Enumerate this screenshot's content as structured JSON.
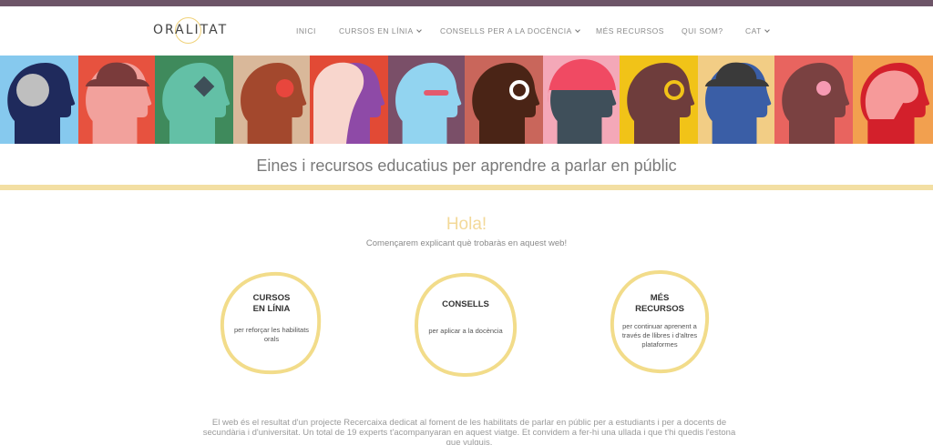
{
  "header": {
    "logo": "ORALITAT",
    "nav": [
      {
        "label": "INICI",
        "dropdown": false
      },
      {
        "label": "CURSOS EN LÍNIA",
        "dropdown": true
      },
      {
        "label": "CONSELLS PER A LA DOCÈNCIA",
        "dropdown": true
      },
      {
        "label": "MÉS RECURSOS",
        "dropdown": false
      },
      {
        "label": "QUI SOM?",
        "dropdown": false
      },
      {
        "label": "CAT",
        "dropdown": true
      }
    ]
  },
  "banner": {
    "tiles": [
      {
        "bg": "#86c9ee",
        "head": "#1f2a5c",
        "accent": "#bfbfbf",
        "motif": "circle-face"
      },
      {
        "bg": "#e7523f",
        "head": "#f2a19c",
        "accent": "#7a3b3b",
        "motif": "hat"
      },
      {
        "bg": "#3f8a5c",
        "head": "#63c0a6",
        "accent": "#3e4f58",
        "motif": "eye-patch"
      },
      {
        "bg": "#d9b89a",
        "head": "#a3482d",
        "accent": "#e8463d",
        "motif": "crown-eye"
      },
      {
        "bg": "#e24a35",
        "head": "#8e4aa7",
        "accent": "#f8d6cd",
        "motif": "hair"
      },
      {
        "bg": "#7a4f68",
        "head": "#92d4f0",
        "accent": "#e45a6d",
        "motif": "visor"
      },
      {
        "bg": "#c9665b",
        "head": "#4a2416",
        "accent": "#ffffff",
        "motif": "glasses"
      },
      {
        "bg": "#f4a8b8",
        "head": "#3f4f5a",
        "accent": "#f04a63",
        "motif": "helmet"
      },
      {
        "bg": "#f1c318",
        "head": "#6e3d3c",
        "accent": "#f1c318",
        "motif": "monocle"
      },
      {
        "bg": "#f2cd85",
        "head": "#3a5ea6",
        "accent": "#3a3a3a",
        "motif": "bowler"
      },
      {
        "bg": "#e8645f",
        "head": "#7a4141",
        "accent": "#f69ab2",
        "motif": "flower"
      },
      {
        "bg": "#f2a04f",
        "head": "#d3202b",
        "accent": "#f69a9a",
        "motif": "brain"
      }
    ]
  },
  "tagline": "Eines i recursos educatius per aprendre a parlar en públic",
  "intro": {
    "title": "Hola!",
    "subtitle": "Començarem explicant què trobaràs en aquest web!"
  },
  "cards": [
    {
      "title": "CURSOS\nEN LÍNIA",
      "text": "per reforçar les habilitats orals"
    },
    {
      "title": "CONSELLS",
      "text": "per aplicar a la docència"
    },
    {
      "title": "MÉS\nRECURSOS",
      "text": "per continuar aprenent a través de llibres i d'altres plataformes"
    }
  ],
  "footer": {
    "text": "El web és el resultat d'un projecte Recercaixa dedicat al foment de les habilitats de parlar en públic per a estudiants i per a docents de secundària i d'universitat. Un total de 19 experts t'acompanyaran en aquest viatge. Et convidem a fer-hi una ullada i que t'hi quedis l'estona que vulguis."
  },
  "colors": {
    "topbar": "#6d5568",
    "accent_yellow": "#f3d999",
    "card_ring": "#f2dc8a"
  }
}
